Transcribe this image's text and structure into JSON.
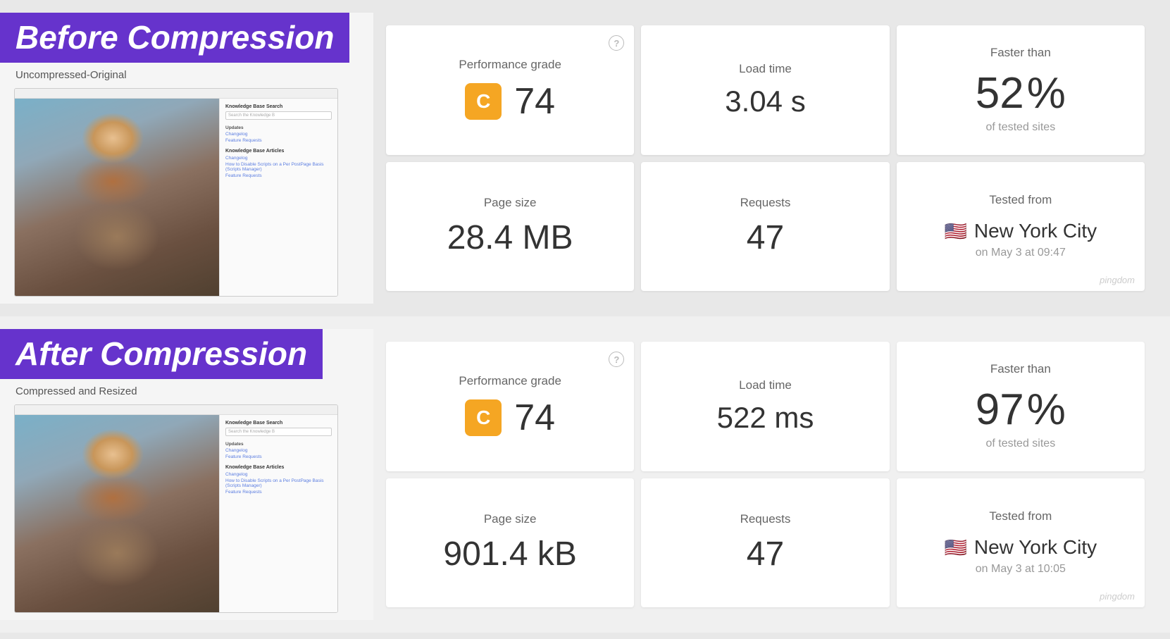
{
  "before": {
    "section_label": "Before Compression",
    "screenshot_sub_label": "Uncompressed-Original",
    "mock_search_placeholder": "Search the Knowledge B",
    "mock_updates_title": "Updates",
    "mock_links": [
      "Changelog",
      "Feature Requests"
    ],
    "mock_kb_title": "Knowledge Base Articles",
    "mock_kb_links": [
      "Changelog",
      "How to Disable Scripts on a Per PostPage Basis (Scripts Manager)",
      "Feature Requests"
    ],
    "performance_label": "Performance grade",
    "performance_grade": "C",
    "performance_number": "74",
    "load_time_label": "Load time",
    "load_time_value": "3.04",
    "load_time_unit": "s",
    "page_size_label": "Page size",
    "page_size_value": "28.4 MB",
    "requests_label": "Requests",
    "requests_value": "47",
    "faster_label": "Faster than",
    "faster_value": "52",
    "faster_percent": "%",
    "faster_sub": "of tested sites",
    "tested_label": "Tested from",
    "tested_city": "New York City",
    "tested_date": "on May 3 at 09:47",
    "help_icon": "?",
    "pingdom": "pingdom"
  },
  "after": {
    "section_label": "After Compression",
    "screenshot_sub_label": "Compressed and Resized",
    "mock_search_placeholder": "Search the Knowledge B",
    "mock_updates_title": "Updates",
    "mock_links": [
      "Changelog",
      "Feature Requests"
    ],
    "mock_kb_title": "Knowledge Base Articles",
    "mock_kb_links": [
      "Changelog",
      "How to Disable Scripts on a Per PostPage Basis (Scripts Manager)",
      "Feature Requests"
    ],
    "performance_label": "Performance grade",
    "performance_grade": "C",
    "performance_number": "74",
    "load_time_label": "Load time",
    "load_time_value": "522",
    "load_time_unit": "ms",
    "page_size_label": "Page size",
    "page_size_value": "901.4 kB",
    "requests_label": "Requests",
    "requests_value": "47",
    "faster_label": "Faster than",
    "faster_value": "97",
    "faster_percent": "%",
    "faster_sub": "of tested sites",
    "tested_label": "Tested from",
    "tested_city": "New York City",
    "tested_date": "on May 3 at 10:05",
    "help_icon": "?",
    "pingdom": "pingdom"
  }
}
